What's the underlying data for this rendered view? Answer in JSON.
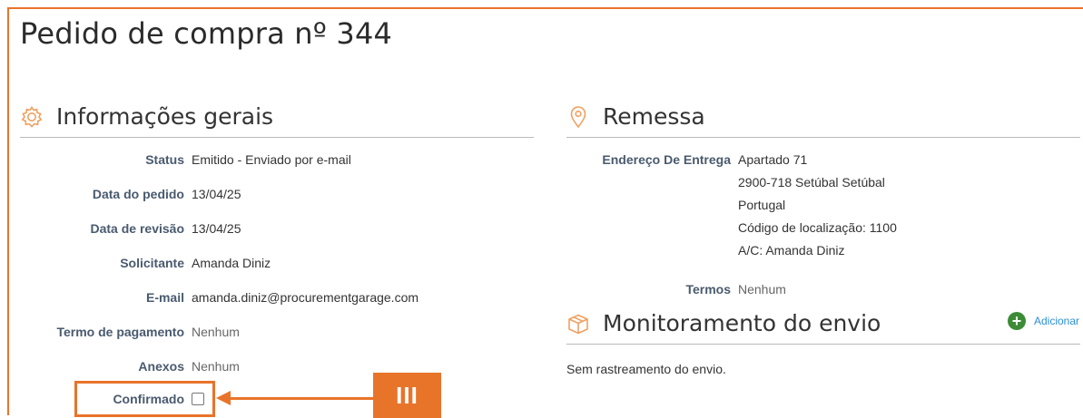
{
  "page": {
    "title": "Pedido de compra nº 344"
  },
  "general_info": {
    "title": "Informações gerais",
    "icon": "gear-icon",
    "fields": {
      "status": {
        "label": "Status",
        "value": "Emitido - Enviado por e-mail"
      },
      "order_date": {
        "label": "Data do pedido",
        "value": "13/04/25"
      },
      "revision_date": {
        "label": "Data de revisão",
        "value": "13/04/25"
      },
      "requester": {
        "label": "Solicitante",
        "value": "Amanda Diniz"
      },
      "email": {
        "label": "E-mail",
        "value": "amanda.diniz@procurementgarage.com"
      },
      "payment_term": {
        "label": "Termo de pagamento",
        "value": "Nenhum"
      },
      "attachments": {
        "label": "Anexos",
        "value": "Nenhum"
      },
      "confirmed": {
        "label": "Confirmado",
        "checked": false
      }
    }
  },
  "shipment": {
    "title": "Remessa",
    "icon": "location-pin-icon",
    "delivery_address": {
      "label": "Endereço De Entrega",
      "lines": [
        "Apartado 71",
        "2900-718 Setúbal Setúbal",
        "Portugal",
        "Código de localização: 1100",
        "A/C: Amanda Diniz"
      ]
    },
    "terms": {
      "label": "Termos",
      "value": "Nenhum"
    }
  },
  "tracking": {
    "title": "Monitoramento do envio",
    "icon": "package-icon",
    "add_label": "Adicionar",
    "empty_text": "Sem rastreamento do envio."
  },
  "annotation": {
    "marker_text": "III",
    "color": "#e8742a"
  }
}
